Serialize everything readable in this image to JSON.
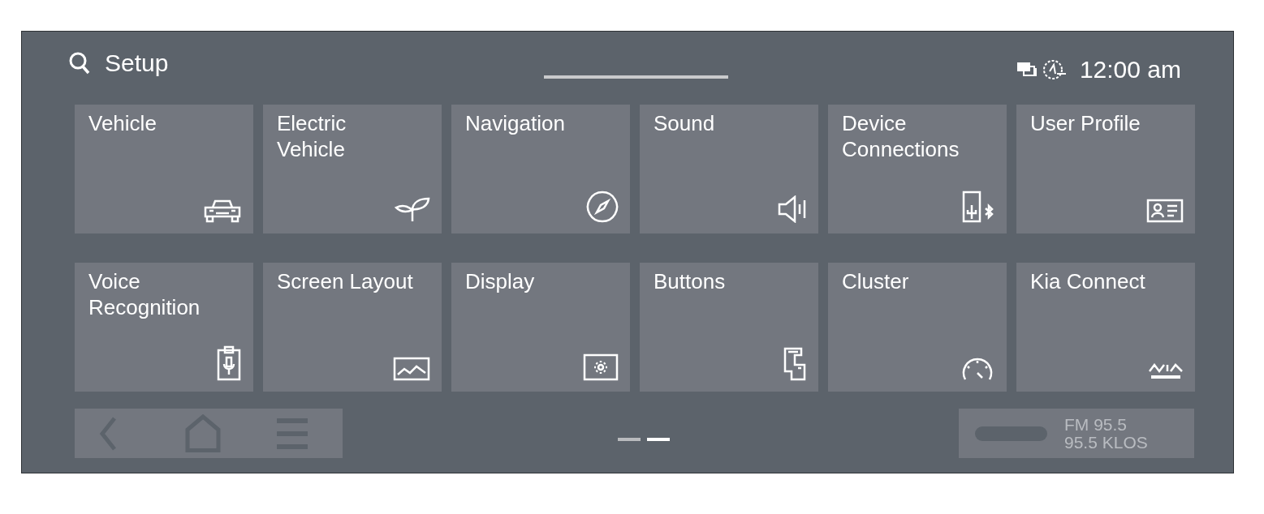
{
  "header": {
    "title": "Setup",
    "time": "12:00 am"
  },
  "tiles": [
    {
      "label": "Vehicle"
    },
    {
      "label": "Electric\nVehicle"
    },
    {
      "label": "Navigation"
    },
    {
      "label": "Sound"
    },
    {
      "label": "Device\nConnections"
    },
    {
      "label": "User Profile"
    },
    {
      "label": "Voice\nRecognition"
    },
    {
      "label": "Screen Layout"
    },
    {
      "label": "Display"
    },
    {
      "label": "Buttons"
    },
    {
      "label": "Cluster"
    },
    {
      "label": "Kia Connect"
    }
  ],
  "pager": [
    {
      "selected": false
    },
    {
      "selected": true
    }
  ],
  "radio": {
    "band": "FM 95.5",
    "station": "95.5 KLOS"
  }
}
